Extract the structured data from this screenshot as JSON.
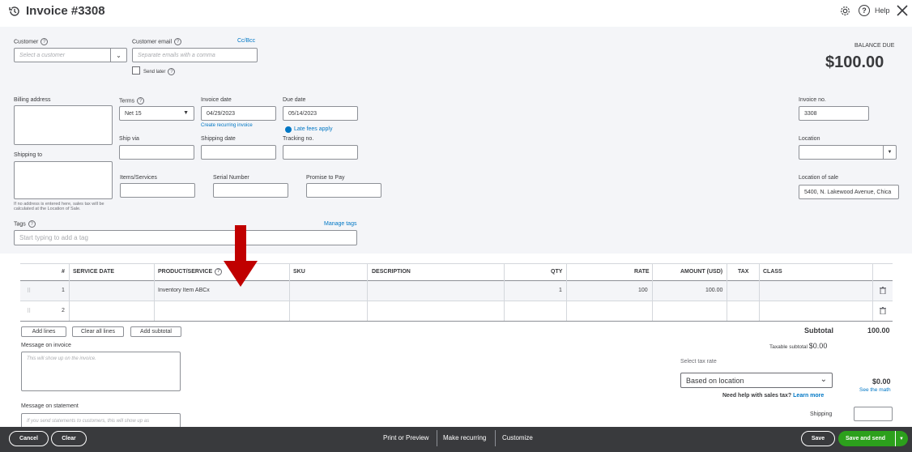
{
  "header": {
    "title": "Invoice #3308",
    "help_label": "Help"
  },
  "customer": {
    "label": "Customer",
    "placeholder": "Select a customer"
  },
  "email": {
    "label": "Customer email",
    "placeholder": "Separate emails with a comma",
    "ccbcc": "Cc/Bcc",
    "send_later": "Send later"
  },
  "balance": {
    "label": "BALANCE DUE",
    "amount": "$100.00"
  },
  "billing": {
    "label": "Billing address"
  },
  "terms": {
    "label": "Terms",
    "value": "Net 15"
  },
  "invoice_date": {
    "label": "Invoice date",
    "value": "04/29/2023",
    "recurring_link": "Create recurring invoice"
  },
  "due_date": {
    "label": "Due date",
    "value": "05/14/2023",
    "late_fees": "Late fees apply"
  },
  "invoice_no": {
    "label": "Invoice no.",
    "value": "3308"
  },
  "ship_via": {
    "label": "Ship via"
  },
  "shipping_date": {
    "label": "Shipping date"
  },
  "tracking": {
    "label": "Tracking no."
  },
  "location": {
    "label": "Location"
  },
  "shipping_to": {
    "label": "Shipping to",
    "note_line1": "If no address is entered here, sales tax will be",
    "note_line2": "calculated at the Location of Sale."
  },
  "items_services": {
    "label": "Items/Services"
  },
  "serial": {
    "label": "Serial Number"
  },
  "promise": {
    "label": "Promise to Pay"
  },
  "location_sale": {
    "label": "Location of sale",
    "value": "5400, N. Lakewood Avenue, Chica"
  },
  "tags": {
    "label": "Tags",
    "manage": "Manage tags",
    "placeholder": "Start typing to add a tag"
  },
  "table": {
    "headers": {
      "num": "#",
      "service_date": "SERVICE DATE",
      "product": "PRODUCT/SERVICE",
      "sku": "SKU",
      "description": "DESCRIPTION",
      "qty": "QTY",
      "rate": "RATE",
      "amount": "AMOUNT (USD)",
      "tax": "TAX",
      "class": "CLASS"
    },
    "rows": [
      {
        "num": "1",
        "product": "Inventory Item ABCx",
        "qty": "1",
        "rate": "100",
        "amount": "100.00"
      },
      {
        "num": "2",
        "product": "",
        "qty": "",
        "rate": "",
        "amount": ""
      }
    ]
  },
  "actions": {
    "add_lines": "Add lines",
    "clear_lines": "Clear all lines",
    "add_subtotal": "Add subtotal"
  },
  "totals": {
    "subtotal_label": "Subtotal",
    "subtotal_value": "100.00",
    "taxable_label": "Taxable subtotal",
    "taxable_value": "$0.00",
    "tax_rate_label": "Select tax rate",
    "tax_rate_value": "Based on location",
    "tax_value": "$0.00",
    "see_math": "See the math",
    "help_sales_tax": "Need help with sales tax?",
    "learn_more": "Learn more",
    "shipping_label": "Shipping"
  },
  "message_invoice": {
    "label": "Message on invoice",
    "placeholder": "This will show up on the invoice."
  },
  "message_statement": {
    "label": "Message on statement",
    "placeholder": "If you send statements to customers, this will show up as"
  },
  "footer": {
    "cancel": "Cancel",
    "clear": "Clear",
    "print_preview": "Print or Preview",
    "make_recurring": "Make recurring",
    "customize": "Customize",
    "save": "Save",
    "save_send": "Save and send"
  },
  "colors": {
    "accent": "#0077c5",
    "save_send": "#2ca01c",
    "footer_bg": "#393a3d",
    "header_bg": "#f4f5f8",
    "arrow": "#c00000"
  }
}
